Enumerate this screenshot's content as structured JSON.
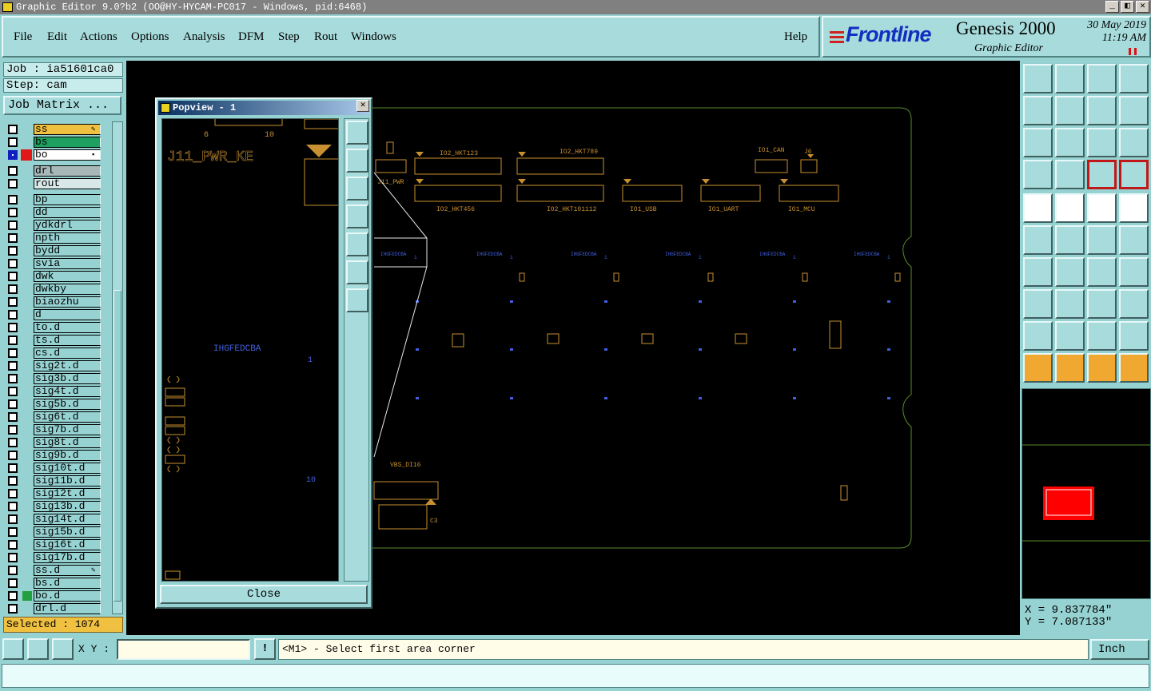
{
  "window": {
    "title": "Graphic Editor 9.0?b2 (OO@HY-HYCAM-PC017 - Windows, pid:6468)",
    "min": "_",
    "max": "◧",
    "close": "✕"
  },
  "menu": {
    "items": [
      "File",
      "Edit",
      "Actions",
      "Options",
      "Analysis",
      "DFM",
      "Step",
      "Rout",
      "Windows"
    ],
    "help": "Help"
  },
  "brand": {
    "logo": "Frontline",
    "product": "Genesis 2000",
    "subtitle": "Graphic Editor",
    "date": "30 May 2019",
    "time": "11:19 AM"
  },
  "job": {
    "job_label": "Job : ia51601ca0",
    "step_label": "Step: cam",
    "matrix_button": "Job Matrix ..."
  },
  "layers": [
    {
      "name": "ss",
      "style": "orange",
      "mark": "pen"
    },
    {
      "name": "bs",
      "style": "green",
      "mark": ""
    },
    {
      "name": "bo",
      "style": "white",
      "mark": "sq",
      "active": true
    },
    {
      "name": "drl",
      "style": "grey",
      "mark": ""
    },
    {
      "name": "rout",
      "style": "light",
      "mark": ""
    },
    {
      "name": "bp",
      "style": "",
      "mark": ""
    },
    {
      "name": "dd",
      "style": "",
      "mark": ""
    },
    {
      "name": "ydkdrl",
      "style": "",
      "mark": ""
    },
    {
      "name": "npth",
      "style": "",
      "mark": ""
    },
    {
      "name": "bydd",
      "style": "",
      "mark": ""
    },
    {
      "name": "svia",
      "style": "",
      "mark": ""
    },
    {
      "name": "dwk",
      "style": "",
      "mark": ""
    },
    {
      "name": "dwkby",
      "style": "",
      "mark": ""
    },
    {
      "name": "biaozhu",
      "style": "",
      "mark": ""
    },
    {
      "name": "d",
      "style": "",
      "mark": ""
    },
    {
      "name": "to.d",
      "style": "",
      "mark": ""
    },
    {
      "name": "ts.d",
      "style": "",
      "mark": ""
    },
    {
      "name": "cs.d",
      "style": "",
      "mark": ""
    },
    {
      "name": "sig2t.d",
      "style": "",
      "mark": ""
    },
    {
      "name": "sig3b.d",
      "style": "",
      "mark": ""
    },
    {
      "name": "sig4t.d",
      "style": "",
      "mark": ""
    },
    {
      "name": "sig5b.d",
      "style": "",
      "mark": ""
    },
    {
      "name": "sig6t.d",
      "style": "",
      "mark": ""
    },
    {
      "name": "sig7b.d",
      "style": "",
      "mark": ""
    },
    {
      "name": "sig8t.d",
      "style": "",
      "mark": ""
    },
    {
      "name": "sig9b.d",
      "style": "",
      "mark": ""
    },
    {
      "name": "sig10t.d",
      "style": "",
      "mark": ""
    },
    {
      "name": "sig11b.d",
      "style": "",
      "mark": ""
    },
    {
      "name": "sig12t.d",
      "style": "",
      "mark": ""
    },
    {
      "name": "sig13b.d",
      "style": "",
      "mark": ""
    },
    {
      "name": "sig14t.d",
      "style": "",
      "mark": ""
    },
    {
      "name": "sig15b.d",
      "style": "",
      "mark": ""
    },
    {
      "name": "sig16t.d",
      "style": "",
      "mark": ""
    },
    {
      "name": "sig17b.d",
      "style": "",
      "mark": ""
    },
    {
      "name": "ss.d",
      "style": "",
      "mark": "pen"
    },
    {
      "name": "bs.d",
      "style": "",
      "mark": ""
    },
    {
      "name": "bo.d",
      "style": "",
      "mark": "",
      "swatch": "green"
    },
    {
      "name": "drl.d",
      "style": "",
      "mark": ""
    }
  ],
  "selected_text": "Selected : 1074",
  "popview": {
    "title": "Popview - 1",
    "close_label": "Close",
    "labels": {
      "top_left": "6",
      "top_mid": "10",
      "pwr": "J11_PWR_KE",
      "hg": "IHGFEDCBA",
      "one": "1",
      "ten": "10"
    }
  },
  "board_labels": {
    "j11": "J11_PWR",
    "hkt123": "IO2_HKT123",
    "hkt789": "IO2_HKT789",
    "can": "IO1_CAN",
    "j6": "J6",
    "hkt456": "IO2_HKT456",
    "hkt10": "IO2_HKT101112",
    "usb": "IO1_USB",
    "uart": "IO1_UART",
    "mcu": "IO1_MCU",
    "vbs": "VBS_DI16",
    "c3": "C3"
  },
  "coords": {
    "x": "X = 9.837784\"",
    "y": "Y = 7.087133\""
  },
  "bottom": {
    "xy_label": "X Y :",
    "xy_value": "",
    "bang": "!",
    "prompt": "<M1> - Select first area corner",
    "unit": "Inch"
  },
  "colors": {
    "panel": "#96d2d2",
    "accent_orange": "#f0a830",
    "board_outline": "#5a8a2a",
    "component": "#c89030",
    "pads": "#4060e0",
    "red": "#ff0000"
  }
}
